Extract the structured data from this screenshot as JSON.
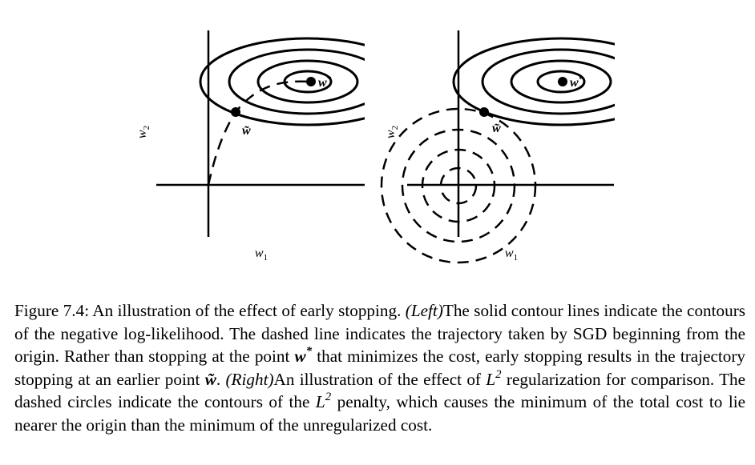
{
  "figure": {
    "left_panel": {
      "x_axis_label": "w1",
      "y_axis_label": "w2",
      "optimum_label": "w*",
      "stop_point_label": "w̃"
    },
    "right_panel": {
      "x_axis_label": "w1",
      "y_axis_label": "w2",
      "optimum_label": "w*",
      "stop_point_label": "w̃"
    }
  },
  "caption": {
    "prefix": "Figure 7.4: An illustration of the effect of early stopping.",
    "left_tag": "(Left)",
    "left_text_1": "The solid contour lines indicate the contours of the negative log-likelihood. The dashed line indicates the trajectory taken by SGD beginning from the origin. Rather than stopping at the point",
    "w_star": "w",
    "w_star_sup": "*",
    "left_text_2": "that minimizes the cost, early stopping results in the trajectory stopping at an earlier point",
    "w_tilde": "w̃",
    "period": ".",
    "right_tag": "(Right)",
    "right_text_1": "An illustration of the effect of",
    "l2": "L",
    "l2_sup": "2",
    "right_text_2": "regularization for comparison. The dashed circles indicate the contours of the",
    "right_text_3": "penalty, which causes the minimum of the total cost to lie nearer the origin than the minimum of the unregularized cost."
  }
}
